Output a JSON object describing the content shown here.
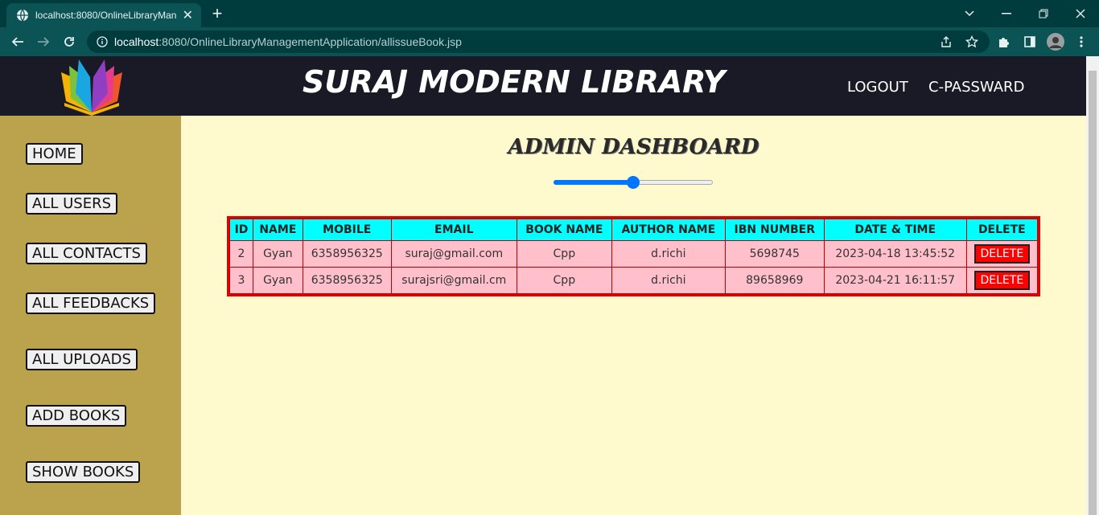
{
  "browser": {
    "tab_title": "localhost:8080/OnlineLibraryMan",
    "url_host": "localhost",
    "url_rest": ":8080/OnlineLibraryManagementApplication/allissueBook.jsp"
  },
  "header": {
    "title": "SURAJ MODERN LIBRARY",
    "logout": "LOGOUT",
    "change_password": "C-PASSWARD"
  },
  "sidebar": {
    "items": [
      {
        "label": "HOME"
      },
      {
        "label": "ALL USERS"
      },
      {
        "label": "ALL CONTACTS"
      },
      {
        "label": "ALL FEEDBACKS"
      },
      {
        "label": "ALL UPLOADS"
      },
      {
        "label": "ADD BOOKS"
      },
      {
        "label": "SHOW BOOKS"
      }
    ]
  },
  "main": {
    "title": "ADMIN DASHBOARD",
    "slider_value": 0.5
  },
  "table": {
    "headers": [
      "ID",
      "NAME",
      "MOBILE",
      "EMAIL",
      "BOOK NAME",
      "AUTHOR NAME",
      "IBN NUMBER",
      "DATE & TIME",
      "DELETE"
    ],
    "rows": [
      {
        "id": "2",
        "name": "Gyan",
        "mobile": "6358956325",
        "email": "suraj@gmail.com",
        "book": "Cpp",
        "author": "d.richi",
        "ibn": "5698745",
        "datetime": "2023-04-18 13:45:52",
        "action": "DELETE"
      },
      {
        "id": "3",
        "name": "Gyan",
        "mobile": "6358956325",
        "email": "surajsri@gmail.cm",
        "book": "Cpp",
        "author": "d.richi",
        "ibn": "89658969",
        "datetime": "2023-04-21 16:11:57",
        "action": "DELETE"
      }
    ]
  },
  "colors": {
    "header_bg": "#1a1a27",
    "sidebar_bg": "#bba34d",
    "page_bg": "#fffacd",
    "table_header_bg": "#00ffff",
    "table_row_bg": "#ffc0cb",
    "table_border": "#e00000",
    "delete_button": "#ff0000",
    "slider": "#0075ff"
  }
}
